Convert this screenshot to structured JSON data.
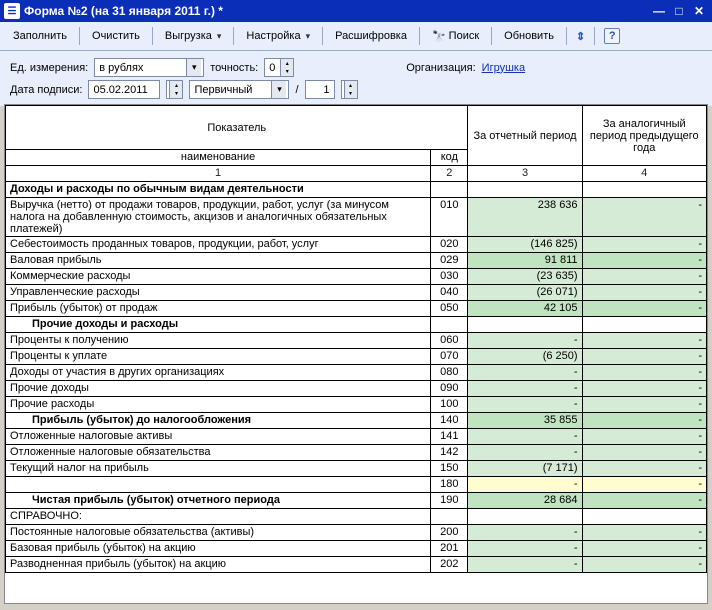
{
  "window": {
    "title": "Форма №2 (на 31 января 2011 г.) *"
  },
  "toolbar": {
    "fill": "Заполнить",
    "clear": "Очистить",
    "export": "Выгрузка",
    "settings": "Настройка",
    "decode": "Расшифровка",
    "search": "Поиск",
    "refresh": "Обновить"
  },
  "params": {
    "unit_label": "Ед. измерения:",
    "unit_value": "в рублях",
    "precision_label": "точность:",
    "precision_value": "0",
    "org_label": "Организация:",
    "org_value": "Игрушка",
    "sign_date_label": "Дата подписи:",
    "sign_date_value": "05.02.2011",
    "kind_value": "Первичный",
    "slash": "/",
    "seq_value": "1"
  },
  "table": {
    "headers": {
      "indicator": "Показатель",
      "name": "наименование",
      "code": "код",
      "period": "За отчетный период",
      "prev": "За аналогичный период предыдущего года",
      "c1": "1",
      "c2": "2",
      "c3": "3",
      "c4": "4"
    },
    "rows": [
      {
        "type": "section",
        "name": "Доходы и расходы по обычным видам деятельности",
        "code": "",
        "v1": "",
        "v2": ""
      },
      {
        "type": "data",
        "name": "Выручка (нетто) от продажи товаров, продукции, работ, услуг (за минусом налога на добавленную стоимость, акцизов и аналогичных обязательных платежей)",
        "code": "010",
        "v1": "238 636",
        "v2": "-",
        "cls": "g1"
      },
      {
        "type": "data",
        "name": "Себестоимость проданных товаров, продукции, работ, услуг",
        "code": "020",
        "v1": "(146 825)",
        "v2": "-",
        "cls": "g1"
      },
      {
        "type": "data",
        "name": "Валовая прибыль",
        "code": "029",
        "v1": "91 811",
        "v2": "-",
        "cls": "g2"
      },
      {
        "type": "data",
        "name": "Коммерческие расходы",
        "code": "030",
        "v1": "(23 635)",
        "v2": "-",
        "cls": "g1"
      },
      {
        "type": "data",
        "name": "Управленческие расходы",
        "code": "040",
        "v1": "(26 071)",
        "v2": "-",
        "cls": "g1"
      },
      {
        "type": "data",
        "name": "Прибыль (убыток) от продаж",
        "code": "050",
        "v1": "42 105",
        "v2": "-",
        "cls": "g2"
      },
      {
        "type": "section",
        "name": "Прочие доходы и расходы",
        "code": "",
        "v1": "",
        "v2": "",
        "lvl": 2
      },
      {
        "type": "data",
        "name": "Проценты к получению",
        "code": "060",
        "v1": "-",
        "v2": "-",
        "cls": "g1"
      },
      {
        "type": "data",
        "name": "Проценты к уплате",
        "code": "070",
        "v1": "(6 250)",
        "v2": "-",
        "cls": "g1"
      },
      {
        "type": "data",
        "name": "Доходы от участия в других организациях",
        "code": "080",
        "v1": "-",
        "v2": "-",
        "cls": "g1"
      },
      {
        "type": "data",
        "name": "Прочие доходы",
        "code": "090",
        "v1": "-",
        "v2": "-",
        "cls": "g1"
      },
      {
        "type": "data",
        "name": "Прочие расходы",
        "code": "100",
        "v1": "-",
        "v2": "-",
        "cls": "g1"
      },
      {
        "type": "section",
        "name": "Прибыль (убыток) до налогообложения",
        "code": "140",
        "v1": "35 855",
        "v2": "-",
        "cls": "g2",
        "lvl": 2,
        "showcode": true
      },
      {
        "type": "data",
        "name": "Отложенные налоговые активы",
        "code": "141",
        "v1": "-",
        "v2": "-",
        "cls": "g1"
      },
      {
        "type": "data",
        "name": "Отложенные налоговые обязательства",
        "code": "142",
        "v1": "-",
        "v2": "-",
        "cls": "g1"
      },
      {
        "type": "data",
        "name": "Текущий налог на прибыль",
        "code": "150",
        "v1": "(7 171)",
        "v2": "-",
        "cls": "g1"
      },
      {
        "type": "data",
        "name": "",
        "code": "180",
        "v1": "-",
        "v2": "-",
        "cls": "y"
      },
      {
        "type": "section",
        "name": "Чистая прибыль (убыток) отчетного периода",
        "code": "190",
        "v1": "28 684",
        "v2": "-",
        "cls": "g2",
        "lvl": 2,
        "showcode": true
      },
      {
        "type": "data",
        "name": "СПРАВОЧНО:",
        "code": "",
        "v1": "",
        "v2": ""
      },
      {
        "type": "data",
        "name": "Постоянные налоговые обязательства (активы)",
        "code": "200",
        "v1": "-",
        "v2": "-",
        "cls": "g1"
      },
      {
        "type": "data",
        "name": "Базовая прибыль (убыток) на акцию",
        "code": "201",
        "v1": "-",
        "v2": "-",
        "cls": "g1"
      },
      {
        "type": "data",
        "name": "Разводненная прибыль (убыток) на акцию",
        "code": "202",
        "v1": "-",
        "v2": "-",
        "cls": "g1"
      }
    ]
  }
}
